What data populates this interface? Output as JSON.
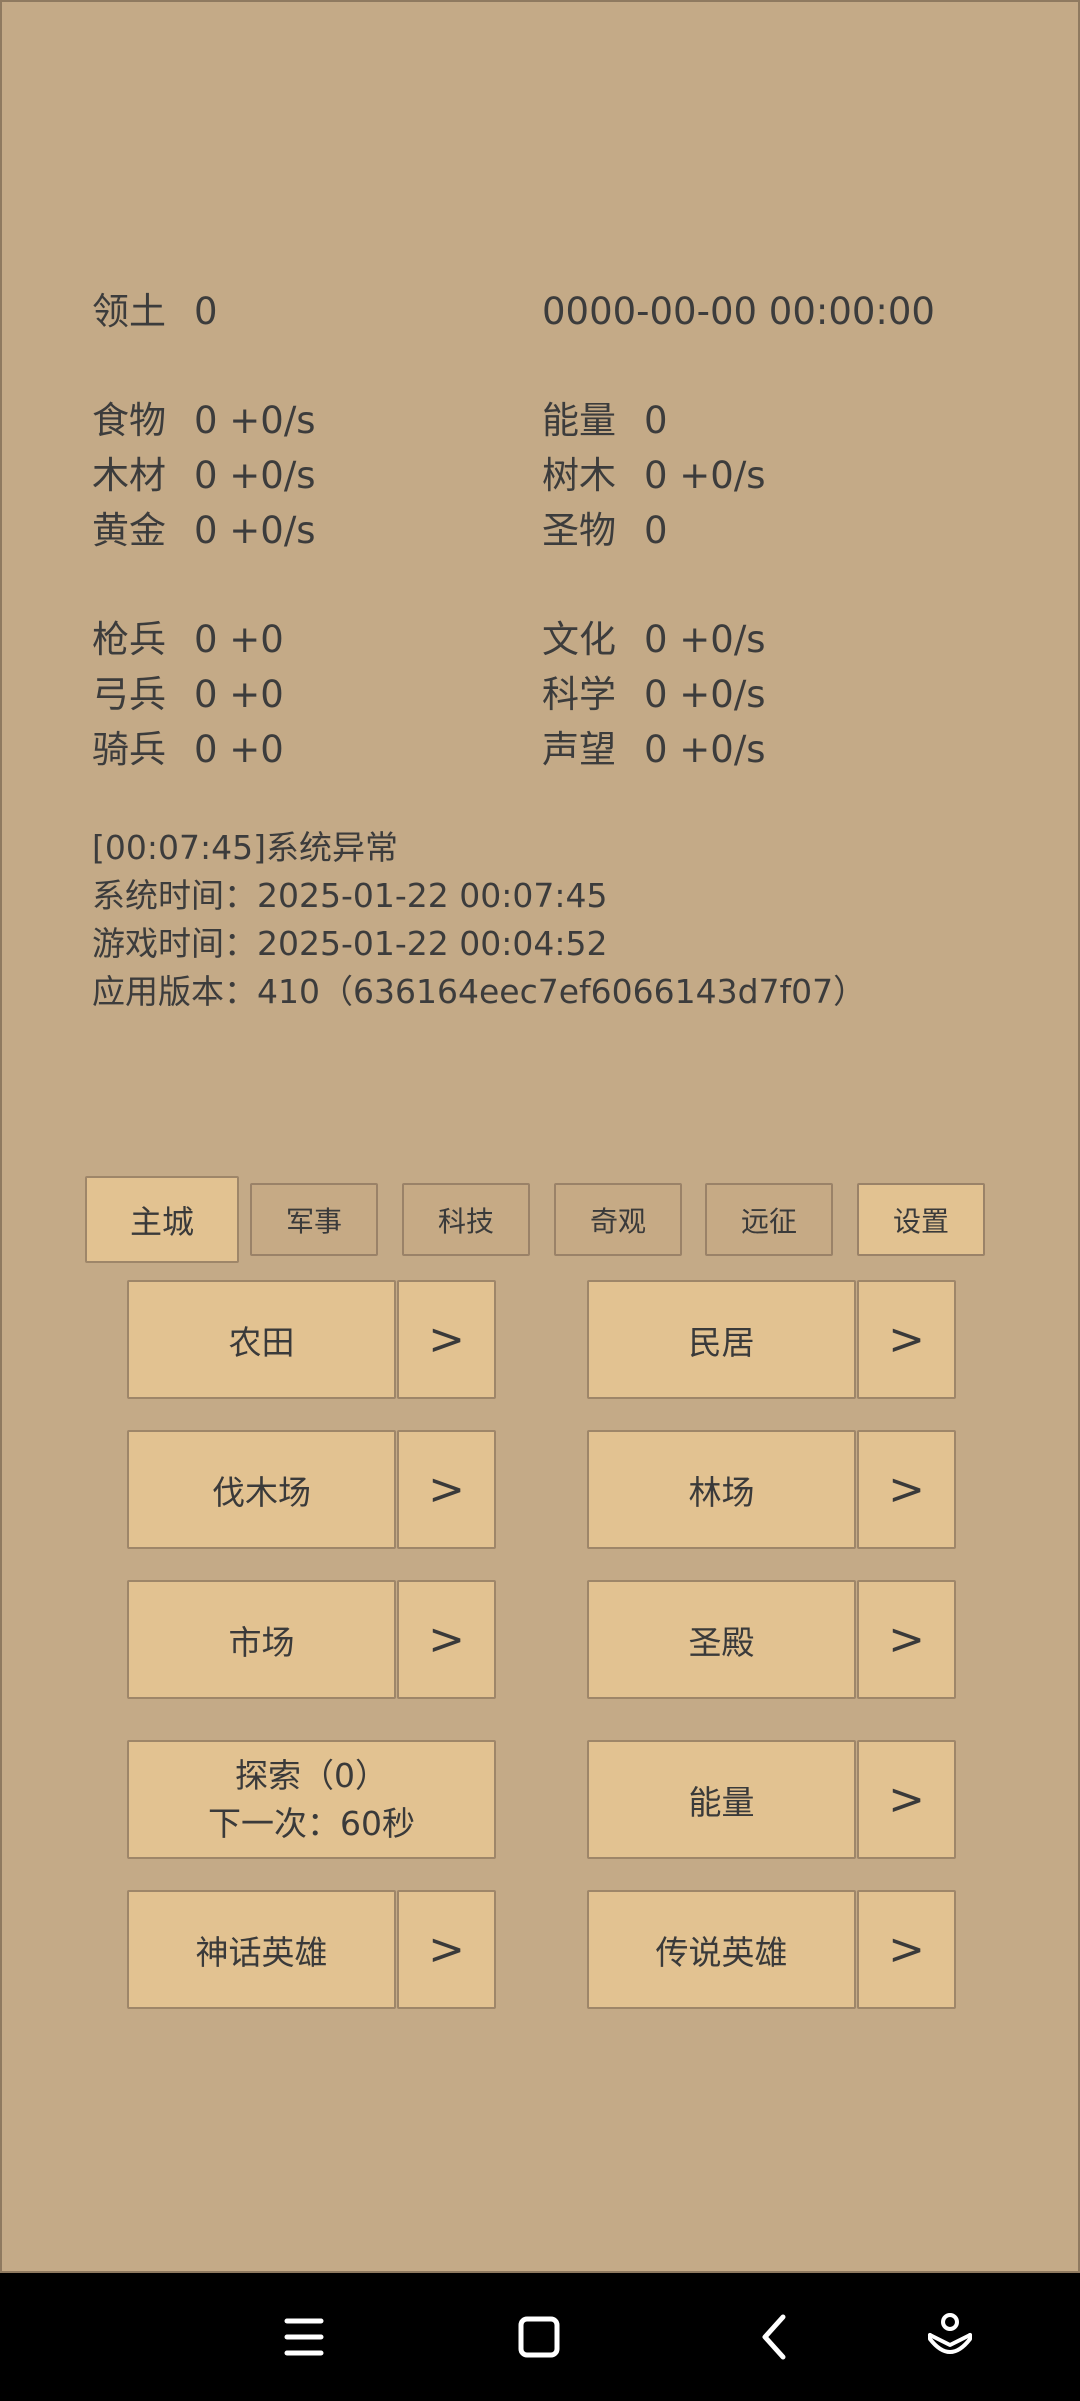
{
  "header": {
    "territory_label": "领土",
    "territory_value": "0",
    "datetime": "0000-00-00  00:00:00"
  },
  "resources_left": [
    {
      "label": "食物",
      "value": "0 +0/s"
    },
    {
      "label": "木材",
      "value": "0 +0/s"
    },
    {
      "label": "黄金",
      "value": "0 +0/s"
    }
  ],
  "resources_right": [
    {
      "label": "能量",
      "value": "0"
    },
    {
      "label": "树木",
      "value": "0 +0/s"
    },
    {
      "label": "圣物",
      "value": "0"
    }
  ],
  "units_left": [
    {
      "label": "枪兵",
      "value": "0 +0"
    },
    {
      "label": "弓兵",
      "value": "0 +0"
    },
    {
      "label": "骑兵",
      "value": "0 +0"
    }
  ],
  "units_right": [
    {
      "label": "文化",
      "value": "0 +0/s"
    },
    {
      "label": "科学",
      "value": "0 +0/s"
    },
    {
      "label": "声望",
      "value": "0 +0/s"
    }
  ],
  "log": {
    "line1": "[00:07:45]系统异常",
    "line2": "系统时间：2025-01-22 00:07:45",
    "line3": "游戏时间：2025-01-22 00:04:52",
    "line4": "应用版本：410（636164eec7ef6066143d7f07）"
  },
  "tabs": [
    "主城",
    "军事",
    "科技",
    "奇观",
    "远征",
    "设置"
  ],
  "buildings": {
    "farm": "农田",
    "house": "民居",
    "lumber": "伐木场",
    "forest": "林场",
    "market": "市场",
    "temple": "圣殿",
    "explore_line1": "探索（0）",
    "explore_line2": "下一次：60秒",
    "energy": "能量",
    "myth_hero": "神话英雄",
    "legend_hero": "传说英雄",
    "arrow": ">"
  },
  "colors": {
    "background": "#c4aa87",
    "button": "#e2c291",
    "tab_inactive": "#c6aa85",
    "navbar": "#000000"
  },
  "navbar_icons": [
    "menu-icon",
    "home-square-icon",
    "back-icon",
    "assistant-icon"
  ]
}
